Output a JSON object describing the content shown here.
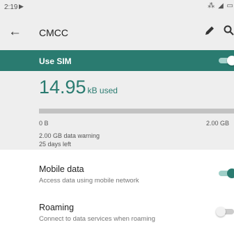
{
  "status_bar": {
    "time": "2:19",
    "icons": [
      "play-store-notification-icon",
      "vibrate-icon",
      "signal-icon",
      "battery-icon"
    ]
  },
  "app_bar": {
    "title": "CMCC",
    "actions": [
      "edit-icon",
      "search-icon"
    ]
  },
  "sim": {
    "label": "Use SIM",
    "enabled": true
  },
  "usage": {
    "amount": "14.95",
    "unit": "kB used",
    "progress_fraction": 0.0,
    "scale_min": "0 B",
    "scale_max": "2.00 GB",
    "warning": "2.00 GB data warning",
    "days_left": "25 days left"
  },
  "settings": [
    {
      "title": "Mobile data",
      "subtitle": "Access data using mobile network",
      "enabled": true
    },
    {
      "title": "Roaming",
      "subtitle": "Connect to data services when roaming",
      "enabled": false
    }
  ],
  "colors": {
    "accent": "#2a7b70",
    "panel_bg": "#eeeeee"
  }
}
